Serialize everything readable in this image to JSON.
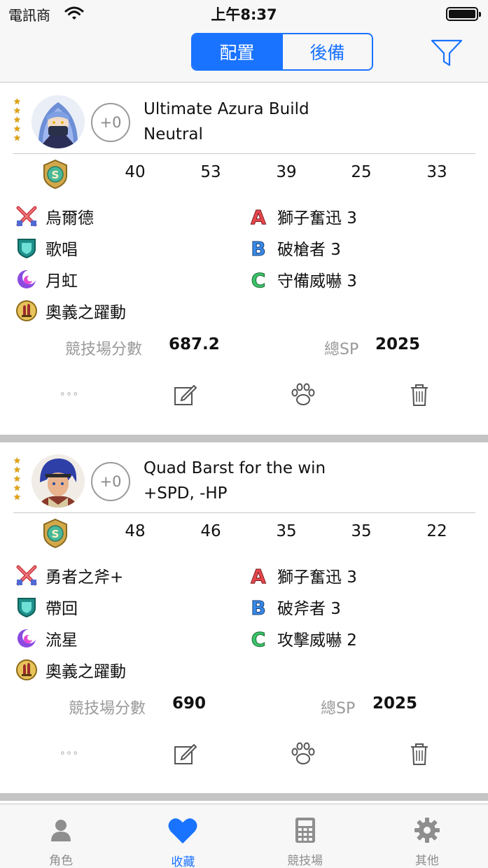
{
  "status_bar": {
    "carrier": "電訊商",
    "time": "上午8:37"
  },
  "nav": {
    "segments": [
      "配置",
      "後備"
    ],
    "active_segment": 0
  },
  "builds": [
    {
      "name": "Ultimate Azura Build",
      "ivs": "Neutral",
      "merges": "+0",
      "rarity": 5,
      "stats": [
        "40",
        "53",
        "39",
        "25",
        "33"
      ],
      "weapon": "烏爾德",
      "assist": "歌唱",
      "special": "月虹",
      "sacred_seal": "奧義之躍動",
      "skill_a": "獅子奮迅 3",
      "skill_b": "破槍者 3",
      "skill_c": "守備威嚇 3",
      "arena_label": "競技場分數",
      "arena_score": "687.2",
      "sp_label": "總SP",
      "sp_total": "2025"
    },
    {
      "name": "Quad Barst for the win",
      "ivs": "+SPD, -HP",
      "merges": "+0",
      "rarity": 5,
      "stats": [
        "48",
        "46",
        "35",
        "35",
        "22"
      ],
      "weapon": "勇者之斧+",
      "assist": "帶回",
      "special": "流星",
      "sacred_seal": "奧義之躍動",
      "skill_a": "獅子奮迅 3",
      "skill_b": "破斧者 3",
      "skill_c": "攻擊威嚇 2",
      "arena_label": "競技場分數",
      "arena_score": "690",
      "sp_label": "總SP",
      "sp_total": "2025"
    }
  ],
  "actions": {
    "more": "◦◦◦"
  },
  "tabs": [
    {
      "label": "角色",
      "icon": "person-icon"
    },
    {
      "label": "收藏",
      "icon": "heart-icon"
    },
    {
      "label": "競技場",
      "icon": "calculator-icon"
    },
    {
      "label": "其他",
      "icon": "gear-icon"
    }
  ],
  "active_tab": 1,
  "colors": {
    "accent": "#1a73ff",
    "separator": "#c4c4c4",
    "muted_text": "#999999",
    "star": "#e6a300"
  }
}
